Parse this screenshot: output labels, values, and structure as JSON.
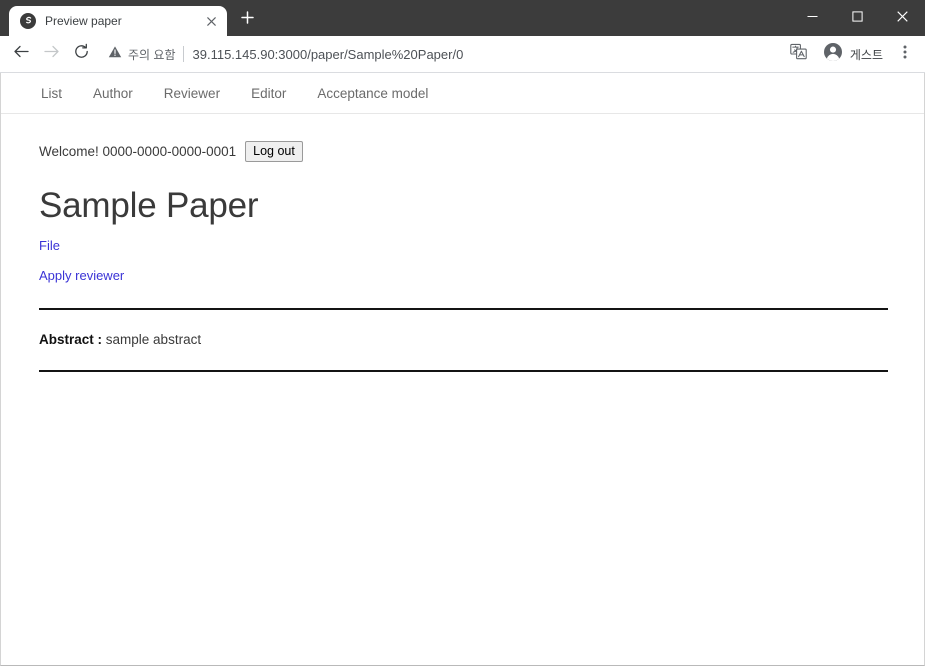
{
  "browser": {
    "tab": {
      "title": "Preview paper",
      "favicon_icon": "globe-swirl-icon",
      "close_icon": "close-icon"
    },
    "new_tab_icon": "plus-icon",
    "window_controls": {
      "minimize_icon": "minimize-icon",
      "maximize_icon": "maximize-icon",
      "close_icon": "window-close-icon"
    },
    "toolbar": {
      "back_icon": "back-arrow-icon",
      "forward_icon": "forward-arrow-icon",
      "reload_icon": "reload-icon",
      "security_icon": "warning-triangle-icon",
      "security_label": "주의 요함",
      "url": "39.115.145.90:3000/paper/Sample%20Paper/0",
      "translate_icon": "translate-icon",
      "profile_icon": "account-circle-icon",
      "profile_label": "게스트",
      "menu_icon": "three-dot-menu-icon"
    }
  },
  "site_nav": {
    "items": [
      {
        "label": "List"
      },
      {
        "label": "Author"
      },
      {
        "label": "Reviewer"
      },
      {
        "label": "Editor"
      },
      {
        "label": "Acceptance model"
      }
    ]
  },
  "page": {
    "welcome_text": "Welcome! 0000-0000-0000-0001",
    "logout_label": "Log out",
    "paper_title": "Sample Paper",
    "file_link_label": "File",
    "apply_reviewer_link_label": "Apply reviewer",
    "abstract_label": "Abstract :",
    "abstract_value": "sample abstract"
  },
  "colors": {
    "tabstrip_bg": "#3c3c3c",
    "link_blue": "#3a33d6",
    "nav_text": "#6b6b6b",
    "rule": "#141414"
  }
}
